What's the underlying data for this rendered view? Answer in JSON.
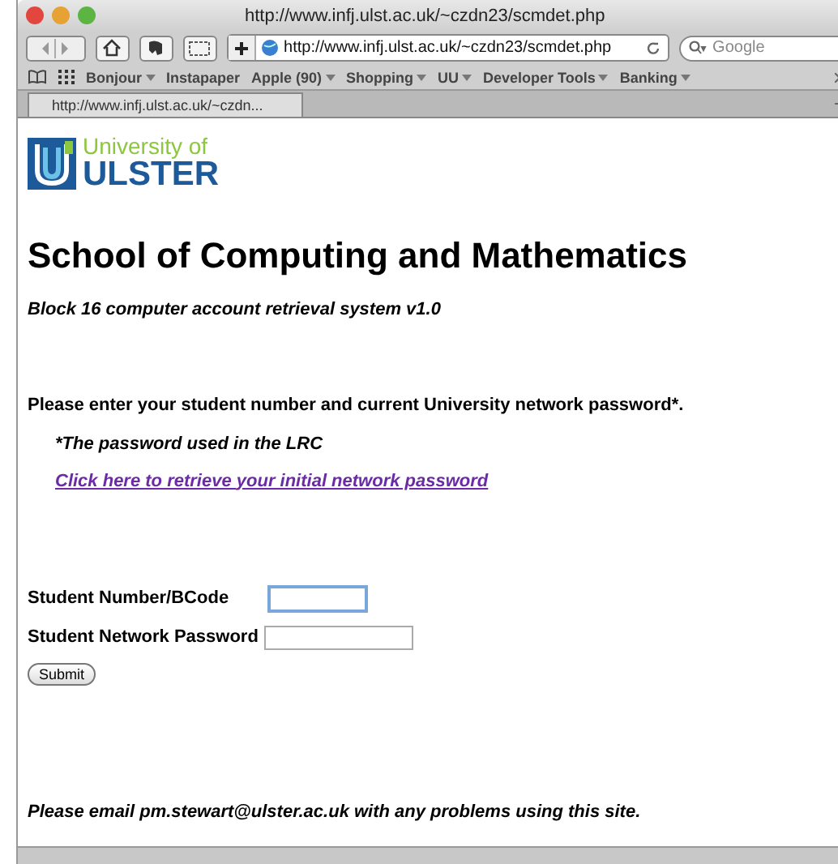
{
  "window": {
    "title": "http://www.infj.ulst.ac.uk/~czdn23/scmdet.php"
  },
  "toolbar": {
    "address": "http://www.infj.ulst.ac.uk/~czdn23/scmdet.php",
    "search_placeholder": "Google"
  },
  "bookmarks": [
    {
      "label": "Bonjour",
      "menu": true
    },
    {
      "label": "Instapaper",
      "menu": false
    },
    {
      "label": "Apple (90)",
      "menu": true
    },
    {
      "label": "Shopping",
      "menu": true
    },
    {
      "label": "UU",
      "menu": true
    },
    {
      "label": "Developer Tools",
      "menu": true
    },
    {
      "label": "Banking",
      "menu": true
    }
  ],
  "tabs": [
    {
      "label": "http://www.infj.ulst.ac.uk/~czdn...",
      "selected": true
    }
  ],
  "page": {
    "logo": {
      "line1": "University of",
      "line2": "ULSTER"
    },
    "heading": "School of Computing and Mathematics",
    "subtitle": "Block 16 computer account retrieval system v1.0",
    "instruction": "Please enter your student number and current University network password*.",
    "note": "*The password used in the LRC",
    "link": "Click here to retrieve your initial network password",
    "fields": [
      {
        "label": "Student Number/BCode",
        "focused": true
      },
      {
        "label": "Student Network Password",
        "focused": false
      }
    ],
    "submit": "Submit",
    "footer": "Please email pm.stewart@ulster.ac.uk with any problems using this site."
  }
}
